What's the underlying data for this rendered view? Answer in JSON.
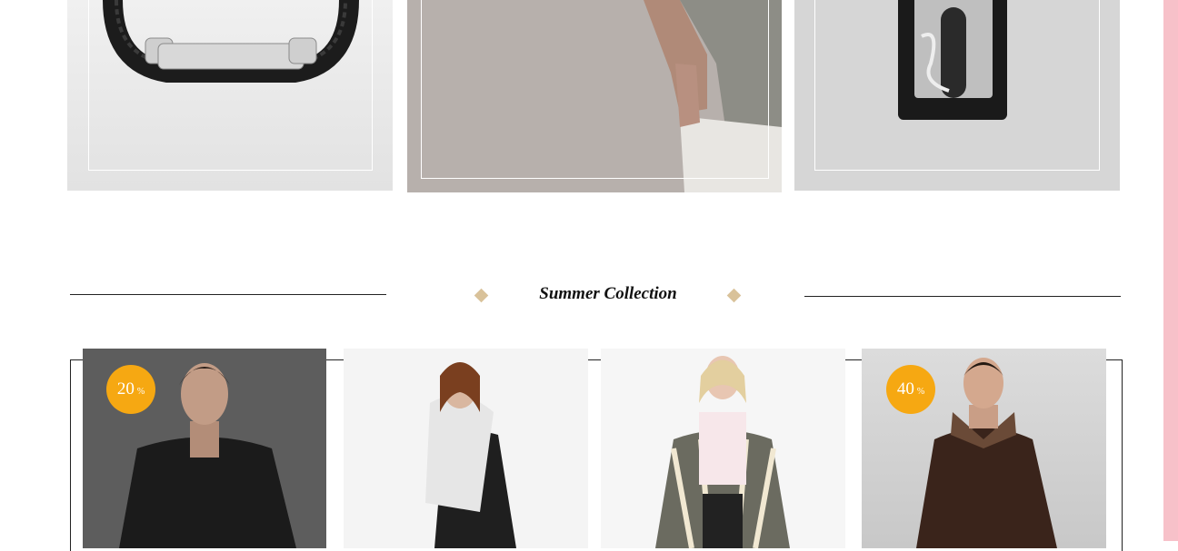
{
  "banners": [
    {
      "name": "bracelet",
      "icon": "bracelet-image"
    },
    {
      "name": "model",
      "icon": "model-image"
    },
    {
      "name": "card-holder",
      "icon": "card-holder-image"
    }
  ],
  "section": {
    "title": "Summer Collection"
  },
  "products": [
    {
      "badge_value": "20",
      "badge_unit": "%"
    },
    {
      "badge_value": null,
      "badge_unit": null
    },
    {
      "badge_value": null,
      "badge_unit": null
    },
    {
      "badge_value": "40",
      "badge_unit": "%"
    }
  ],
  "colors": {
    "badge": "#f6a812",
    "diamond": "#d9c29a",
    "side_bar": "#f7c1c9"
  }
}
